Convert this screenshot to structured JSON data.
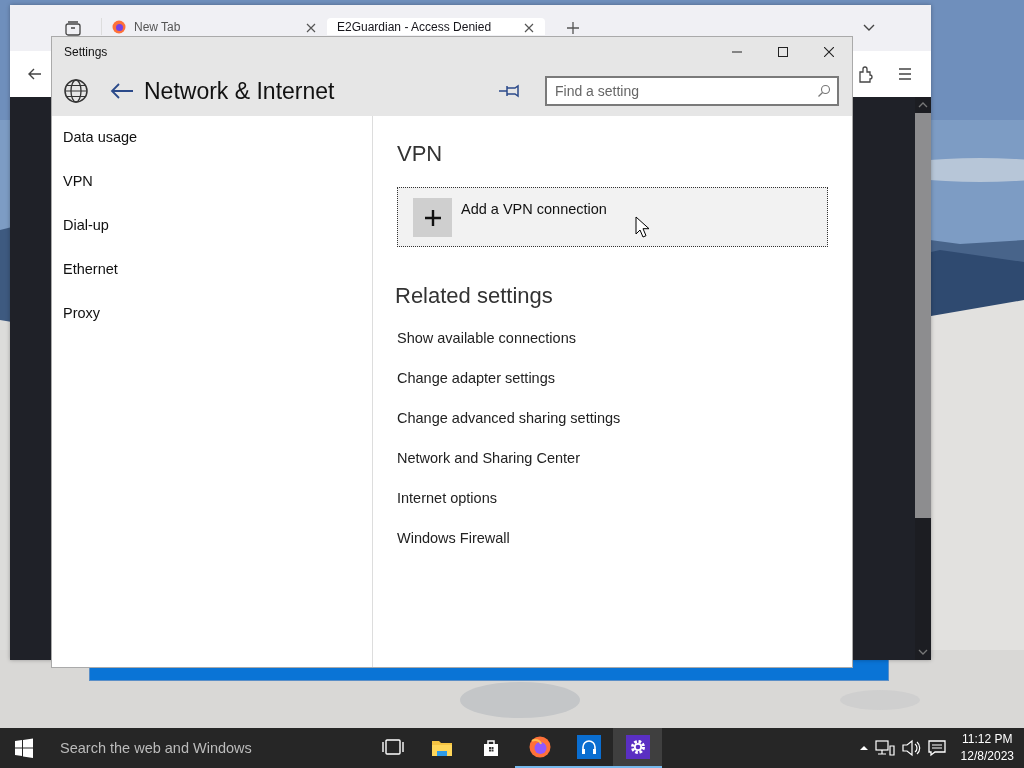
{
  "browser": {
    "tabs": [
      {
        "label": "New Tab",
        "selected": false
      },
      {
        "label": "E2Guardian - Access Denied",
        "selected": true
      }
    ]
  },
  "settings": {
    "window": {
      "title": "Settings"
    },
    "header": {
      "title": "Network & Internet",
      "search": {
        "placeholder": "Find a setting"
      }
    },
    "sidebar": {
      "items": [
        {
          "label": "Data usage",
          "selected": false
        },
        {
          "label": "VPN",
          "selected": false
        },
        {
          "label": "Dial-up",
          "selected": false
        },
        {
          "label": "Ethernet",
          "selected": false
        },
        {
          "label": "Proxy",
          "selected": false
        }
      ]
    },
    "content": {
      "heading": "VPN",
      "add_button": "Add a VPN connection",
      "related_heading": "Related settings",
      "links": [
        "Show available connections",
        "Change adapter settings",
        "Change advanced sharing settings",
        "Network and Sharing Center",
        "Internet options",
        "Windows Firewall"
      ]
    }
  },
  "taskbar": {
    "search": {
      "placeholder": "Search the web and Windows"
    },
    "apps": [
      {
        "kind": "taskview",
        "running": false,
        "selected": false
      },
      {
        "kind": "folder",
        "running": false,
        "selected": false
      },
      {
        "kind": "store",
        "running": false,
        "selected": false
      },
      {
        "kind": "firefox",
        "running": true,
        "selected": false
      },
      {
        "kind": "headphones",
        "running": true,
        "selected": false
      },
      {
        "kind": "gear",
        "running": true,
        "selected": true
      }
    ],
    "clock": {
      "time": "11:12 PM",
      "date": "12/8/2023"
    }
  }
}
